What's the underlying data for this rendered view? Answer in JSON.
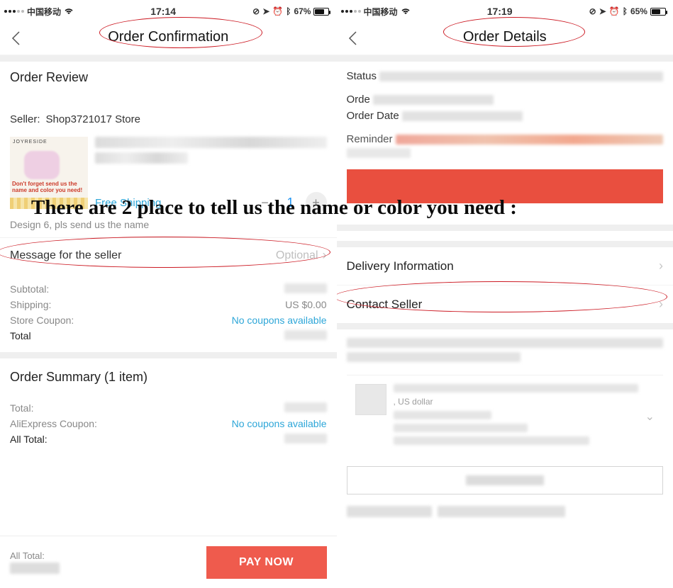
{
  "overlay_caption": "There are 2 place to tell us the name or color you need :",
  "left": {
    "statusbar": {
      "carrier": "中国移动",
      "time": "17:14",
      "battery_text": "67%"
    },
    "title": "Order Confirmation",
    "review_title": "Order Review",
    "seller_label": "Seller:",
    "seller_name": "Shop3721017 Store",
    "product": {
      "brand": "JOYRESIDE",
      "cap1": "Don't forget send us the name and color you need!",
      "shipping_label": "Free Shipping",
      "qty": "1",
      "minus": "−",
      "plus": "+"
    },
    "variant_text": "Design 6, pls send us the name",
    "msg_label": "Message for the seller",
    "msg_placeholder": "Optional",
    "prices": {
      "subtotal_label": "Subtotal:",
      "shipping_label": "Shipping:",
      "shipping_value": "US $0.00",
      "coupon_label": "Store Coupon:",
      "coupon_value": "No coupons available",
      "total_label": "Total"
    },
    "summary_title": "Order Summary (1 item)",
    "summary": {
      "total_label": "Total:",
      "ali_coupon_label": "AliExpress Coupon:",
      "ali_coupon_value": "No coupons available",
      "all_total_label": "All Total:"
    },
    "paybar": {
      "all_total_label": "All Total:",
      "button": "PAY NOW"
    }
  },
  "right": {
    "statusbar": {
      "carrier": "中国移动",
      "time": "17:19",
      "battery_text": "65%"
    },
    "title": "Order Details",
    "meta": {
      "status_label": "Status",
      "order_label": "Orde",
      "order_date_label": "Order Date",
      "reminder_label": "Reminder"
    },
    "delivery_label": "Delivery Information",
    "contact_label": "Contact Seller",
    "order_card": {
      "currency": ", US dollar"
    }
  }
}
